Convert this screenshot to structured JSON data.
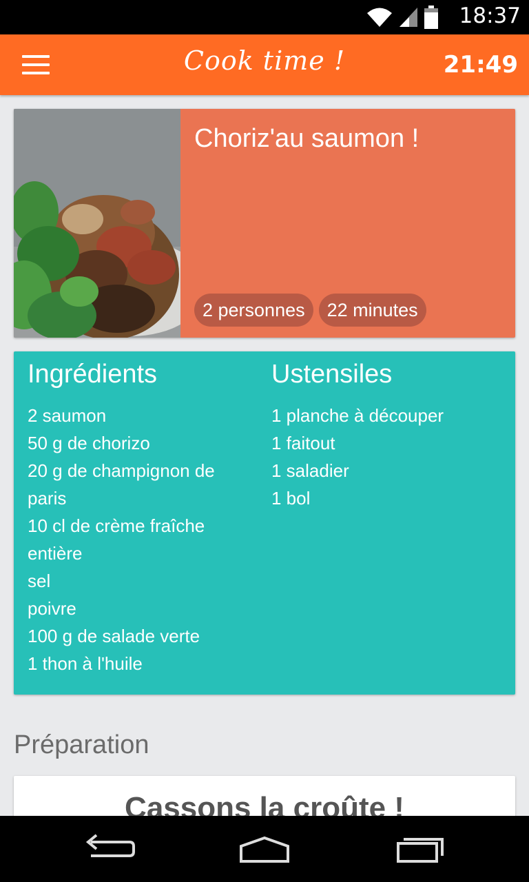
{
  "status_bar": {
    "time": "18:37",
    "icons": [
      "wifi-icon",
      "signal-icon",
      "battery-icon"
    ]
  },
  "app_bar": {
    "title": "Cook time !",
    "timer": "21:49",
    "menu_icon": "menu-icon"
  },
  "recipe": {
    "title": "Choriz'au saumon !",
    "servings": "2 personnes",
    "duration": "22 minutes"
  },
  "ingredients": {
    "heading": "Ingrédients",
    "items": [
      "2 saumon",
      "50 g de chorizo",
      "20 g de champignon de paris",
      "10 cl de crème fraîche entière",
      "sel",
      "poivre",
      "100 g de salade verte",
      "1 thon à l'huile"
    ]
  },
  "utensils": {
    "heading": "Ustensiles",
    "items": [
      "1 planche à découper",
      "1 faitout",
      "1 saladier",
      "1 bol"
    ]
  },
  "preparation": {
    "heading": "Préparation",
    "first_step_title": "Cassons la croûte !"
  },
  "colors": {
    "app_bar": "#ff6b23",
    "recipe_card": "#ea7452",
    "tag": "#b95a45",
    "ingredients_card": "#27c0b8",
    "background": "#e9eaec"
  },
  "nav_bar": {
    "icons": [
      "back-icon",
      "home-icon",
      "recent-apps-icon"
    ]
  }
}
